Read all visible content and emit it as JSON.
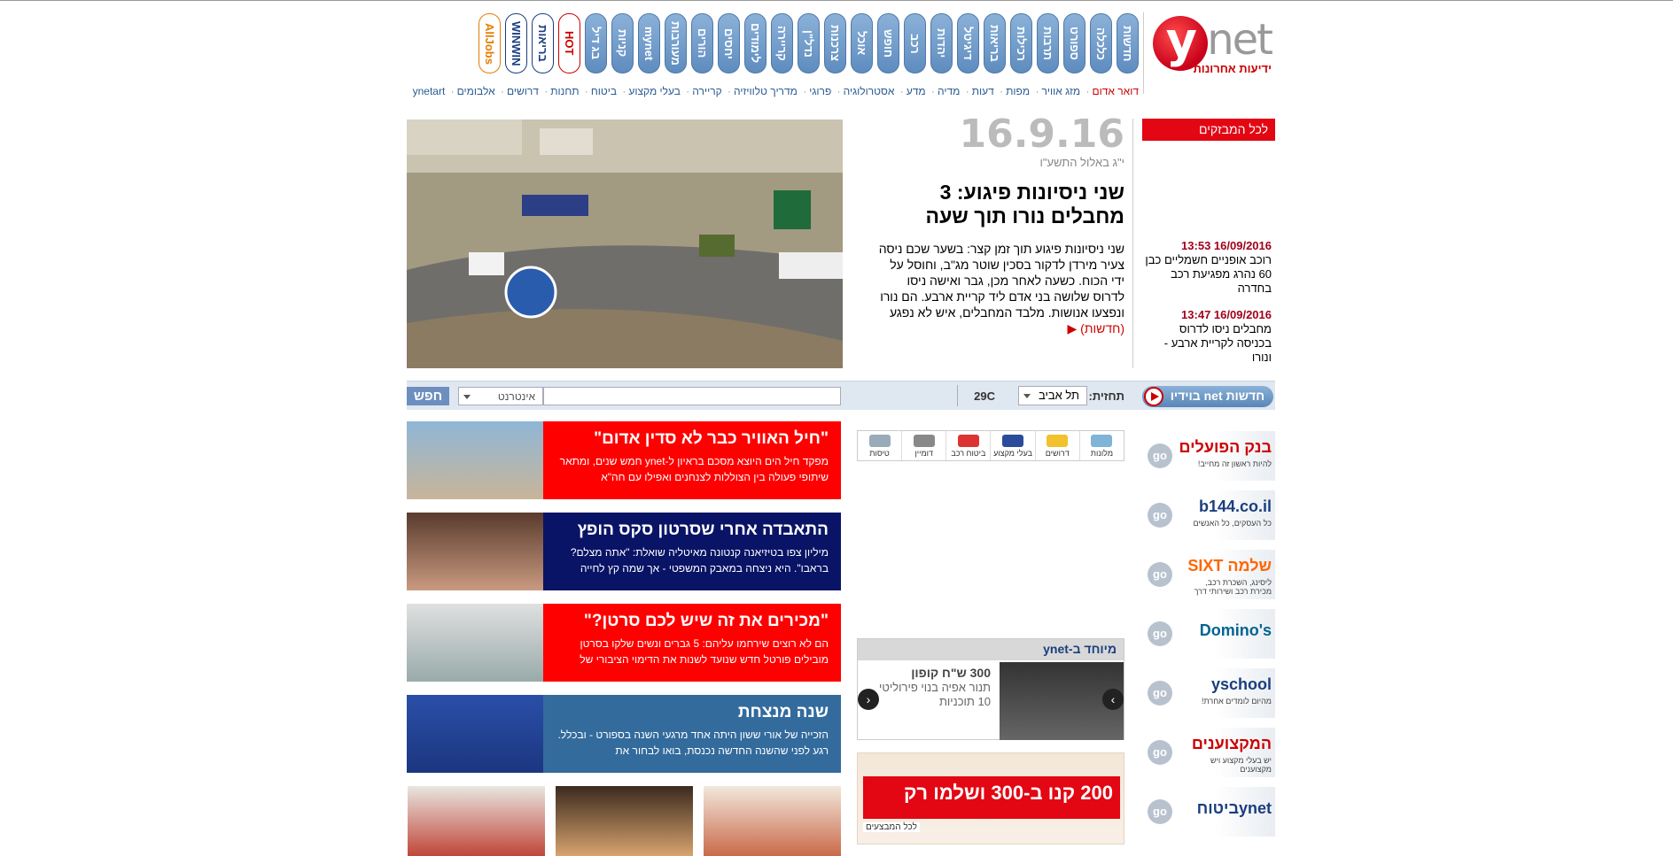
{
  "logo": {
    "y": "y",
    "net": "net",
    "sub": "ידיעות אחרונות"
  },
  "tabs": [
    "חדשות",
    "כלכלה",
    "ספורט",
    "תרבות",
    "רכילות",
    "בריאות",
    "דיגיטל",
    "יהדות",
    "רכב",
    "חופש",
    "אוכל",
    "צרכנות",
    "נדל\"ן",
    "קריירה",
    "לימודים",
    "יחסים",
    "הורים",
    "מעורבות",
    "mynet",
    "קניות",
    "בג דיל",
    "HOT",
    "בריאות",
    "WINWIN",
    "AllJobs"
  ],
  "sublinks": [
    "דואר אדום",
    "מזג אוויר",
    "מפות",
    "דעות",
    "מדיה",
    "מדע",
    "אסטרולוגיה",
    "פרוגי",
    "מדריך טלוויזיה",
    "קריירה",
    "בעלי מקצוע",
    "ביטוח",
    "תחנות",
    "דרושים",
    "אלבומים",
    "ynetart"
  ],
  "flash": {
    "title": "לכל המבזקים",
    "items": [
      {
        "time": "16/09/2016 13:53",
        "text": "רוכב אופניים חשמליים כבן 60 נהרג מפגיעת רכב בחדרה"
      },
      {
        "time": "16/09/2016 13:47",
        "text": "מחבלים ניסו לדרוס בכניסה לקריית ארבע - ונורו"
      }
    ]
  },
  "main": {
    "date": "16.9.16",
    "hebdate": "י\"ג באלול התשע\"ו",
    "headline": "שני ניסיונות פיגוע: 3 מחבלים נורו תוך שעה",
    "lede": "שני ניסיונות פיגוע תוך זמן קצר: בשער שכם ניסה צעיר מירדן לדקור בסכין שוטר מג\"ב, וחוסל על ידי הכוח. כשעה לאחר מכן, גבר ואישה ניסו לדרוס שלושה בני אדם ליד קריית ארבע. הם נורו ונפצעו אנושות. מלבד המחבלים, איש לא נפגע",
    "source": "(חדשות)"
  },
  "searchbar": {
    "video_label": "חדשות net בוידיו",
    "forecast_label": "תחזית:",
    "city": "תל אביב",
    "temp": "29C",
    "search_scope": "אינטרנט",
    "search_button": "חפש"
  },
  "promos": [
    {
      "name": "בנק הפועלים",
      "sub": "להיות ראשון זה מחייב!",
      "go": "go"
    },
    {
      "name": "b144.co.il",
      "sub": "כל העסקים, כל האנשים",
      "go": "go"
    },
    {
      "name": "שלמה SIXT",
      "sub": "ליסינג, השכרת רכב, מכירת רכב ושירותי דרך",
      "go": "go"
    },
    {
      "name": "Domino's",
      "sub": "",
      "go": "go"
    },
    {
      "name": "yschool",
      "sub": "מהיום לומדים אחרת!",
      "go": "go"
    },
    {
      "name": "המקצוענים",
      "sub": "יש בעלי מקצוע ויש מקצוענים",
      "go": "go"
    },
    {
      "name": "ynetביטוח",
      "sub": "",
      "go": "go"
    }
  ],
  "shortcuts": [
    "מלונות",
    "דרושים",
    "בעלי מקצוע",
    "ביטוח רכב",
    "דומיין",
    "טיסות"
  ],
  "special": {
    "head": "מיוחד ב-ynet",
    "price": "300 ש\"ח קופון",
    "desc": "תנור אפיה בנוי פירוליטי 10 תוכניות"
  },
  "ad": {
    "text": "200 קנו ב-300 ושלמו רק",
    "foot": "לכל המבצעים"
  },
  "stories": [
    {
      "title": "\"חיל האוויר כבר לא סדין אדום\"",
      "body": "מפקד חיל הים היוצא מסכם בראיון ל-ynet חמש שנים, ומתאר שיתופי פעולה בין הצוללות לצנחנים ואפילו עם חה\"א",
      "color": "#ff0000"
    },
    {
      "title": "התאבדה אחרי שסרטון סקס הופץ",
      "body": "מיליון צפו בטיזיאנה קנטונה מאיטליה שואלת: \"אתה מצלם? בראבו\". היא ניצחה במאבק המשפטי - אך שמה קץ לחייה",
      "color": "#0a1466"
    },
    {
      "title": "\"מכירים את זה שיש לכם סרטן?\"",
      "body": "הם לא רוצים שירחמו עליהם: 5 גברים ונשים שלקו בסרטן מובילים פורטל חדש שנועד לשנות את הדימוי הציבורי של",
      "color": "#ff0000"
    },
    {
      "title": "שנה מנצחת",
      "body": "הזכייה של אורי ששון היתה אחד מרגעי השנה בספורט - ובכלל. רגע לפני שהשנה החדשה נכנסת, בואו לבחור את",
      "color": "#336b9d"
    }
  ],
  "colors": {
    "accent": "#e30613",
    "nav": "#5f8cbf",
    "link": "#2b5b93"
  }
}
